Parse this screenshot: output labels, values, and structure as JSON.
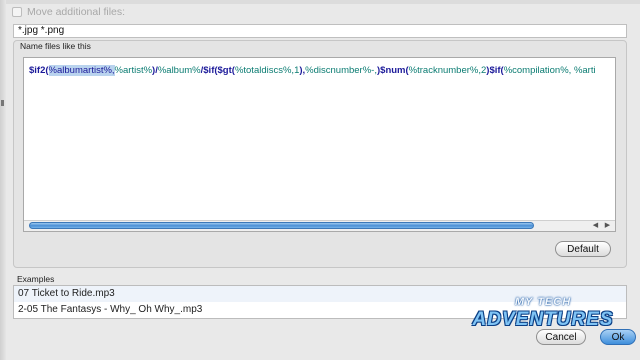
{
  "move_files": {
    "label": "Move additional files:"
  },
  "extensions_field": {
    "value": "*.jpg *.png"
  },
  "name_files": {
    "group_label": "Name files like this",
    "pattern_segments": [
      {
        "text": "$if2(",
        "style": "f"
      },
      {
        "text": "%albumartist%,",
        "style": "sel"
      },
      {
        "text": "%artist%",
        "style": "t"
      },
      {
        "text": ")/",
        "style": "f"
      },
      {
        "text": "%album%",
        "style": "t"
      },
      {
        "text": "/",
        "style": "f"
      },
      {
        "text": "$if(",
        "style": "f"
      },
      {
        "text": "$gt(",
        "style": "f"
      },
      {
        "text": "%totaldiscs%,1",
        "style": "t"
      },
      {
        "text": "),",
        "style": "f"
      },
      {
        "text": "%discnumber%-,",
        "style": "t"
      },
      {
        "text": ")",
        "style": "f"
      },
      {
        "text": "$num(",
        "style": "f"
      },
      {
        "text": "%tracknumber%,2",
        "style": "t"
      },
      {
        "text": ")",
        "style": "f"
      },
      {
        "text": "$if(",
        "style": "f"
      },
      {
        "text": "%compilation%, ",
        "style": "t"
      },
      {
        "text": "%arti",
        "style": "t"
      }
    ],
    "scroll_left": "◀",
    "scroll_right": "▶",
    "default_button": "Default"
  },
  "examples": {
    "label": "Examples",
    "rows": [
      "07 Ticket to Ride.mp3",
      "2-05 The Fantasys - Why_ Oh Why_.mp3"
    ]
  },
  "buttons": {
    "cancel": "Cancel",
    "ok": "Ok"
  },
  "watermark": {
    "line1": "MY TECH",
    "line2": "ADVENTURES"
  }
}
